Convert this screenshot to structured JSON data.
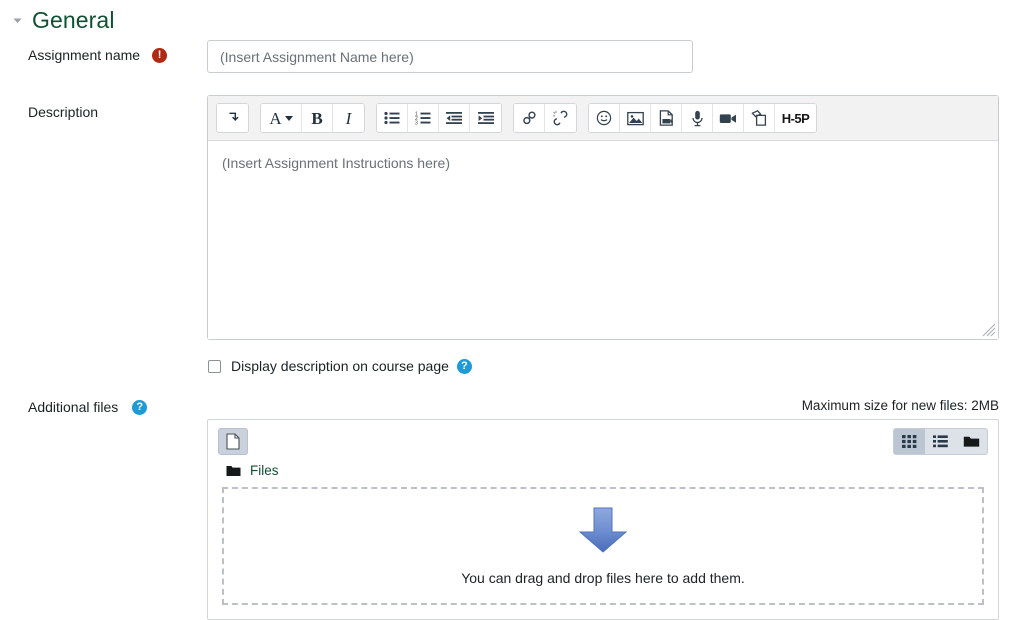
{
  "section": {
    "title": "General",
    "collapse_icon": "caret-down-icon"
  },
  "fields": {
    "assignment_name": {
      "label": "Assignment name",
      "required_marker": "!",
      "required_icon": "required-exclamation-icon",
      "value": "",
      "placeholder": "(Insert Assignment Name here)"
    },
    "description": {
      "label": "Description",
      "value": "",
      "placeholder": "(Insert Assignment Instructions here)"
    },
    "additional_files": {
      "label": "Additional files",
      "help_icon": "help-question-icon",
      "help_marker": "?"
    }
  },
  "editor": {
    "toolbar_groups": [
      {
        "name": "expand",
        "buttons": [
          {
            "name": "show-more-toolbar-button",
            "icon": "arrow-turn-down-icon",
            "label": "Show more buttons"
          }
        ]
      },
      {
        "name": "style",
        "buttons": [
          {
            "name": "font-style-button",
            "icon": "letter-a-dropdown-icon",
            "label": "A",
            "has_caret": true
          },
          {
            "name": "bold-button",
            "icon": "bold-icon",
            "label": "B"
          },
          {
            "name": "italic-button",
            "icon": "italic-icon",
            "label": "I"
          }
        ]
      },
      {
        "name": "lists",
        "buttons": [
          {
            "name": "unordered-list-button",
            "icon": "bulleted-list-icon",
            "label": "Bulleted list"
          },
          {
            "name": "ordered-list-button",
            "icon": "numbered-list-icon",
            "label": "Numbered list"
          },
          {
            "name": "outdent-button",
            "icon": "outdent-icon",
            "label": "Decrease indent"
          },
          {
            "name": "indent-button",
            "icon": "indent-icon",
            "label": "Increase indent"
          }
        ]
      },
      {
        "name": "links",
        "buttons": [
          {
            "name": "link-button",
            "icon": "link-chain-icon",
            "label": "Link"
          },
          {
            "name": "unlink-button",
            "icon": "broken-chain-icon",
            "label": "Unlink"
          }
        ]
      },
      {
        "name": "media",
        "buttons": [
          {
            "name": "emoji-button",
            "icon": "smiley-face-icon",
            "label": "Emoji picker"
          },
          {
            "name": "insert-image-button",
            "icon": "image-picture-icon",
            "label": "Image"
          },
          {
            "name": "insert-media-button",
            "icon": "media-file-icon",
            "label": "Media"
          },
          {
            "name": "record-audio-button",
            "icon": "microphone-icon",
            "label": "Record audio"
          },
          {
            "name": "record-video-button",
            "icon": "video-camera-icon",
            "label": "Record video"
          },
          {
            "name": "manage-files-button",
            "icon": "copy-files-icon",
            "label": "Manage files"
          },
          {
            "name": "h5p-button",
            "icon": "h5p-icon",
            "label": "H-5P"
          }
        ]
      }
    ]
  },
  "display_description": {
    "label": "Display description on course page",
    "checked": false,
    "help_icon": "help-question-icon",
    "help_marker": "?"
  },
  "filemanager": {
    "max_size_note": "Maximum size for new files: 2MB",
    "add_file_button": {
      "name": "add-file-button",
      "icon": "blank-page-icon",
      "label": "Add..."
    },
    "views": [
      {
        "name": "view-grid-button",
        "icon": "grid-view-icon",
        "label": "Display as icons",
        "active": true
      },
      {
        "name": "view-list-button",
        "icon": "list-view-icon",
        "label": "Display as list",
        "active": false
      },
      {
        "name": "view-tree-button",
        "icon": "folder-tree-icon",
        "label": "Display folder tree",
        "active": false
      }
    ],
    "breadcrumb": {
      "icon": "folder-icon",
      "label": "Files"
    },
    "dropzone": {
      "arrow_icon": "blue-down-arrow-icon",
      "text": "You can drag and drop files here to add them."
    }
  },
  "colors": {
    "section_title": "#0f5132",
    "required": "#b02a13",
    "help": "#1e9bd7",
    "link": "#0f5132",
    "arrow": "#5b7fc4"
  }
}
